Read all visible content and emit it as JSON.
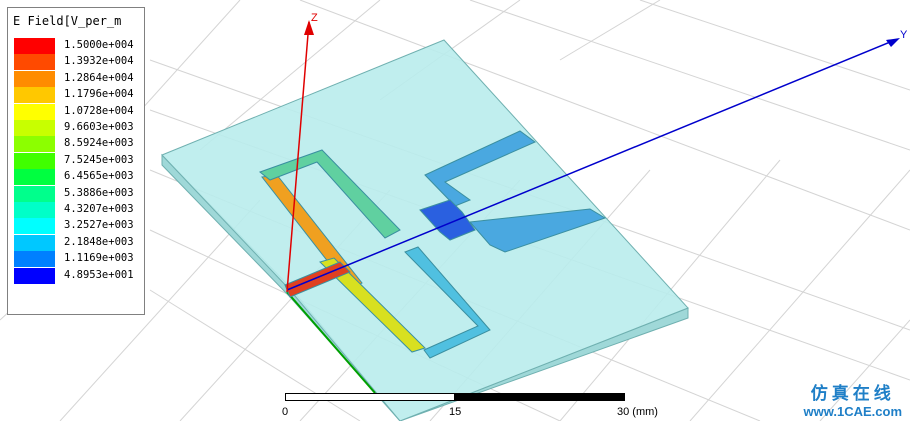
{
  "legend": {
    "title": "E Field[V_per_m",
    "entries": [
      {
        "label": "1.5000e+004",
        "color": "#ff0000"
      },
      {
        "label": "1.3932e+004",
        "color": "#ff4a00"
      },
      {
        "label": "1.2864e+004",
        "color": "#ff8c00"
      },
      {
        "label": "1.1796e+004",
        "color": "#ffc800"
      },
      {
        "label": "1.0728e+004",
        "color": "#ffff00"
      },
      {
        "label": "9.6603e+003",
        "color": "#c8ff00"
      },
      {
        "label": "8.5924e+003",
        "color": "#8cff00"
      },
      {
        "label": "7.5245e+003",
        "color": "#40ff00"
      },
      {
        "label": "6.4565e+003",
        "color": "#00ff40"
      },
      {
        "label": "5.3886e+003",
        "color": "#00ff8c"
      },
      {
        "label": "4.3207e+003",
        "color": "#00ffc8"
      },
      {
        "label": "3.2527e+003",
        "color": "#00ffff"
      },
      {
        "label": "2.1848e+003",
        "color": "#00c8ff"
      },
      {
        "label": "1.1169e+003",
        "color": "#0080ff"
      },
      {
        "label": "4.8953e+001",
        "color": "#0000ff"
      }
    ]
  },
  "axes": {
    "z": "Z",
    "y": "Y"
  },
  "scale_bar": {
    "labels": [
      "0",
      "15",
      "30 (mm)"
    ]
  },
  "watermark": {
    "cn": "仿真在线",
    "en": "www.1CAE.com"
  },
  "colors": {
    "substrate": "#b9ecec",
    "z_axis": "#e00000",
    "y_axis": "#0000cc",
    "x_axis": "#00a000"
  }
}
